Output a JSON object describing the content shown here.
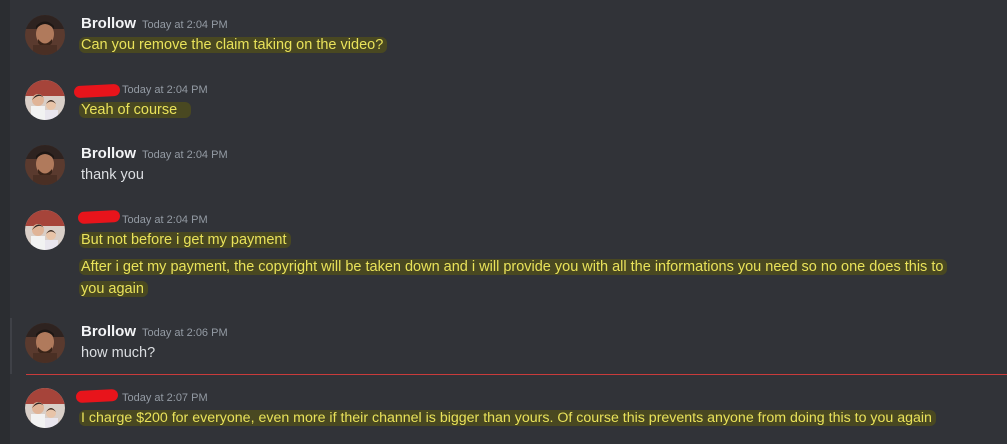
{
  "messages": [
    {
      "author": "Brollow",
      "time": "Today at 2:04 PM",
      "avatar": "dark-haired-man-icon",
      "lines": [
        "Can you remove the claim taking on the video?"
      ],
      "highlighted": true
    },
    {
      "author": "",
      "time": "Today at 2:04 PM",
      "avatar": "family-photo-icon",
      "lines": [
        "Yeah of course"
      ],
      "highlighted": true
    },
    {
      "author": "Brollow",
      "time": "Today at 2:04 PM",
      "avatar": "dark-haired-man-icon",
      "lines": [
        "thank you"
      ],
      "highlighted": false
    },
    {
      "author": "",
      "time": "Today at 2:04 PM",
      "avatar": "family-photo-icon",
      "lines": [
        "But not before i get my payment",
        "After i get my payment, the copyright will be taken down and i will provide you with all the informations you need so no one does this to",
        "you again"
      ],
      "highlighted": true
    },
    {
      "author": "Brollow",
      "time": "Today at 2:06 PM",
      "avatar": "dark-haired-man-icon",
      "lines": [
        "how much?"
      ],
      "highlighted": false
    },
    {
      "author": "",
      "time": "Today at 2:07 PM",
      "avatar": "family-photo-icon",
      "lines": [
        "I charge $200 for everyone, even more if their channel is bigger than yours. Of course this prevents anyone from doing this to you again"
      ],
      "highlighted": true
    }
  ],
  "colors": {
    "background": "#313338",
    "highlight_text": "#e9e25a",
    "redaction": "#e8141b",
    "new_messages_divider": "#c93b3b"
  }
}
